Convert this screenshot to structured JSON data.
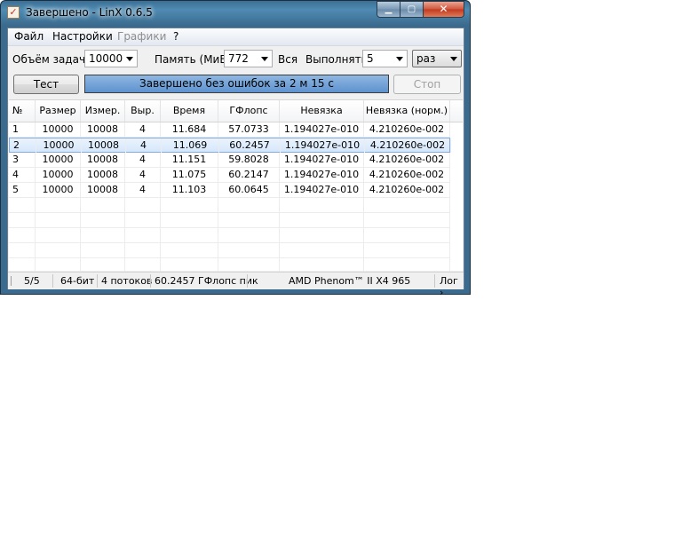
{
  "window": {
    "title": "Завершено - LinX 0.6.5"
  },
  "menu": {
    "file": "Файл",
    "settings": "Настройки",
    "graphs": "Графики",
    "help": "?"
  },
  "controls": {
    "task_size_label": "Объём задачи:",
    "task_size_value": "10000",
    "memory_label": "Память (МиБ):",
    "memory_value": "772",
    "all_label": "Вся",
    "run_label": "Выполнять:",
    "run_value": "5",
    "run_unit": "раз",
    "test_button": "Тест",
    "stop_button": "Стоп",
    "progress_text": "Завершено без ошибок за 2 м 15 с",
    "progress_fraction": 1.0
  },
  "table": {
    "columns": [
      "№",
      "Размер",
      "Измер.",
      "Выр.",
      "Время",
      "ГФлопс",
      "Невязка",
      "Невязка (норм.)"
    ],
    "rows": [
      [
        "1",
        "10000",
        "10008",
        "4",
        "11.684",
        "57.0733",
        "1.194027e-010",
        "4.210260e-002"
      ],
      [
        "2",
        "10000",
        "10008",
        "4",
        "11.069",
        "60.2457",
        "1.194027e-010",
        "4.210260e-002"
      ],
      [
        "3",
        "10000",
        "10008",
        "4",
        "11.151",
        "59.8028",
        "1.194027e-010",
        "4.210260e-002"
      ],
      [
        "4",
        "10000",
        "10008",
        "4",
        "11.075",
        "60.2147",
        "1.194027e-010",
        "4.210260e-002"
      ],
      [
        "5",
        "10000",
        "10008",
        "4",
        "11.103",
        "60.0645",
        "1.194027e-010",
        "4.210260e-002"
      ]
    ],
    "selected_row": 1
  },
  "status": {
    "progress": "5/5",
    "bits": "64-бит",
    "threads": "4 потоков",
    "peak": "60.2457 ГФлопс пик",
    "cpu": "AMD Phenom™ II X4 965",
    "log": "Лог ›"
  },
  "colors": {
    "progress_fill": "#6f9fd8",
    "selection": "#d6e7fb",
    "title_bar": "#4f8bb3"
  }
}
